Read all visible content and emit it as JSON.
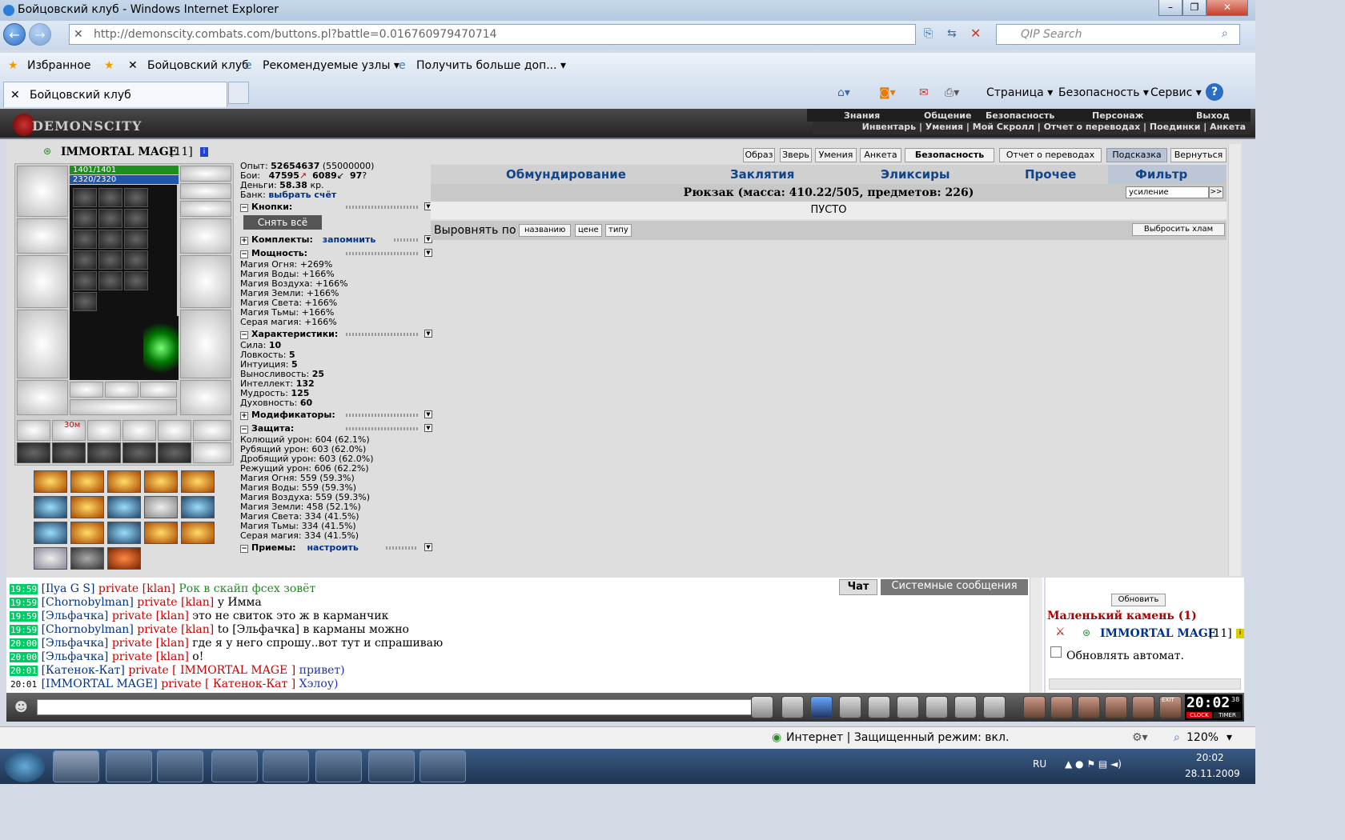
{
  "window": {
    "title": "Бойцовский клуб - Windows Internet Explorer",
    "minimize": "–",
    "maximize": "❐",
    "close": "✕"
  },
  "address": {
    "url": "http://demonscity.combats.com/buttons.pl?battle=0.016760979470714",
    "search_placeholder": "QIP Search"
  },
  "favorites": {
    "fav_label": "Избранное",
    "site1": "Бойцовский клуб",
    "site2": "Рекомендуемые узлы ▾",
    "site3": "Получить больше доп... ▾"
  },
  "tab": {
    "title": "Бойцовский клуб"
  },
  "commandbar": {
    "page": "Страница ▾",
    "security": "Безопасность ▾",
    "service": "Сервис ▾",
    "help": "?"
  },
  "game_header": {
    "logo": "DEMONSCITY",
    "menu_top": [
      "Знания",
      "Общение",
      "Безопасность",
      "Персонаж",
      "Выход"
    ],
    "menu_bottom": "Инвентарь | Умения | Мой Скролл | Отчет о переводах | Поединки | Анкета"
  },
  "character": {
    "name": "IMMORTAL MAGE",
    "level": "[11]",
    "hp": "1401/1401",
    "mana": "2320/2320",
    "slot_time": "30м"
  },
  "stats": {
    "exp_label": "Опыт:",
    "exp": "52654637",
    "exp_next": "(55000000)",
    "battles_label": "Бои:",
    "wins": "47595",
    "losses": "6089",
    "draws": "97",
    "money_label": "Деньги:",
    "money": "58.38",
    "money_unit": "кр.",
    "bank_label": "Банк:",
    "bank_link": "выбрать счёт",
    "buttons_title": "Кнопки:",
    "remove_all": "Снять всё",
    "sets_title": "Комплекты:",
    "sets_link": "запомнить",
    "power_title": "Мощность:",
    "power": [
      "Магия Огня: +269%",
      "Магия Воды: +166%",
      "Магия Воздуха: +166%",
      "Магия Земли: +166%",
      "Магия Света: +166%",
      "Магия Тьмы: +166%",
      "Серая магия: +166%"
    ],
    "chars_title": "Характеристики:",
    "chars": [
      {
        "k": "Сила:",
        "v": "10"
      },
      {
        "k": "Ловкость:",
        "v": "5"
      },
      {
        "k": "Интуиция:",
        "v": "5"
      },
      {
        "k": "Выносливость:",
        "v": "25"
      },
      {
        "k": "Интеллект:",
        "v": "132"
      },
      {
        "k": "Мудрость:",
        "v": "125"
      },
      {
        "k": "Духовность:",
        "v": "60"
      }
    ],
    "mods_title": "Модификаторы:",
    "defense_title": "Защита:",
    "defense": [
      "Колющий урон: 604 (62.1%)",
      "Рубящий урон: 603 (62.0%)",
      "Дробящий урон: 603 (62.0%)",
      "Режущий урон: 606 (62.2%)",
      "Магия Огня: 559 (59.3%)",
      "Магия Воды: 559 (59.3%)",
      "Магия Воздуха: 559 (59.3%)",
      "Магия Земли: 458 (52.1%)",
      "Магия Света: 334 (41.5%)",
      "Магия Тьмы: 334 (41.5%)",
      "Серая магия: 334 (41.5%)"
    ],
    "tricks_title": "Приемы:",
    "tricks_link": "настроить"
  },
  "top_buttons": [
    "Образ",
    "Зверь",
    "Умения",
    "Анкета",
    "Безопасность",
    "Отчет о переводах",
    "Подсказка",
    "Вернуться"
  ],
  "inventory": {
    "tabs": [
      "Обмундирование",
      "Заклятия",
      "Эликсиры",
      "Прочее"
    ],
    "filter_label": "Фильтр",
    "filter_value": "усиление",
    "filter_go": ">>",
    "backpack": "Рюкзак (масса: 410.22/505, предметов: 226)",
    "empty": "ПУСТО",
    "sort_label": "Выровнять по",
    "sort_options": [
      "названию",
      "цене",
      "типу"
    ],
    "trash": "Выбросить хлам"
  },
  "chat": {
    "tab_chat": "Чат",
    "tab_system": "Системные сообщения",
    "lines": [
      {
        "t": "19:59",
        "n": "[Ilya G S]",
        "p": "private [klan]",
        "m": "Рок в скайп фсех зовёт",
        "mc": "#228822"
      },
      {
        "t": "19:59",
        "n": "[Chornobylman]",
        "p": "private [klan]",
        "m": "у Имма",
        "mc": "#000"
      },
      {
        "t": "19:59",
        "n": "[Эльфачка]",
        "p": "private [klan]",
        "m": "это не свиток это ж в карманчик",
        "mc": "#000"
      },
      {
        "t": "19:59",
        "n": "[Chornobylman]",
        "p": "private [klan]",
        "m": "to [Эльфачка] в карманы можно",
        "mc": "#000"
      },
      {
        "t": "20:00",
        "n": "[Эльфачка]",
        "p": "private [klan]",
        "m": "где я у него спрошу..вот тут и спрашиваю",
        "mc": "#000"
      },
      {
        "t": "20:00",
        "n": "[Эльфачка]",
        "p": "private [klan]",
        "m": "о!",
        "mc": "#000"
      },
      {
        "t": "20:01",
        "n": "[Катенок-Кат]",
        "p": "private [ IMMORTAL MAGE ]",
        "m": "привет)",
        "mc": "#2233aa"
      },
      {
        "t": "20:01",
        "n": "[IMMORTAL MAGE]",
        "p": "private [ Катенок-Кат ]",
        "m": "Хэлоу)",
        "mc": "#2233aa"
      }
    ]
  },
  "right_panel": {
    "refresh": "Обновить",
    "location": "Маленький камень (1)",
    "player": "IMMORTAL MAGE",
    "player_level": "[11]",
    "auto_refresh": "Обновлять автомат."
  },
  "clock": {
    "time": "20:02",
    "sec": "38",
    "clock_lbl": "CLOCK",
    "timer_lbl": "TIMER",
    "exit": "EXIT"
  },
  "statusbar": {
    "zone": "Интернет | Защищенный режим: вкл.",
    "zoom": "120%"
  },
  "taskbar": {
    "lang": "RU",
    "time": "20:02",
    "date": "28.11.2009"
  }
}
